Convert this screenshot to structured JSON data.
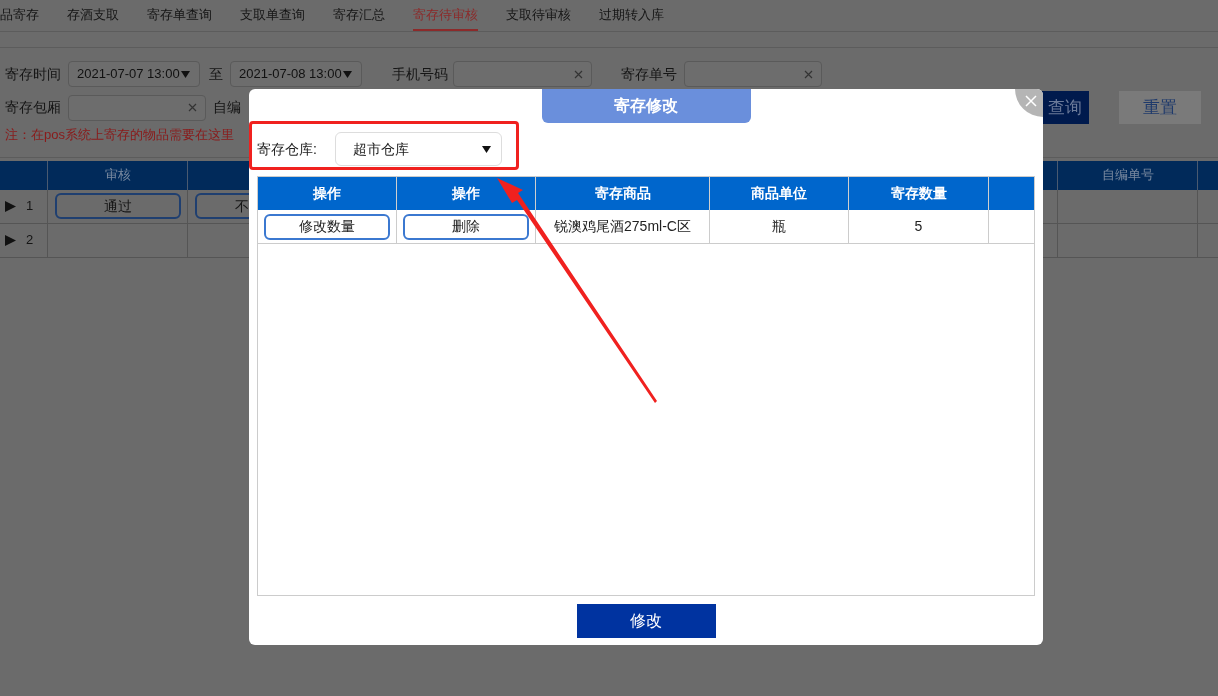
{
  "tabs": [
    {
      "label": "品寄存",
      "selected": false
    },
    {
      "label": "存酒支取",
      "selected": false
    },
    {
      "label": "寄存单查询",
      "selected": false
    },
    {
      "label": "支取单查询",
      "selected": false
    },
    {
      "label": "寄存汇总",
      "selected": false
    },
    {
      "label": "寄存待审核",
      "selected": true
    },
    {
      "label": "支取待审核",
      "selected": false
    },
    {
      "label": "过期转入库",
      "selected": false
    }
  ],
  "filters": {
    "time_label": "寄存时间",
    "time_from": "2021-07-07 13:00",
    "to_label": "至",
    "time_to": "2021-07-08 13:00",
    "phone_label": "手机号码",
    "order_label": "寄存单号",
    "room_label": "寄存包厢",
    "self_no_label": "自编"
  },
  "buttons": {
    "query": "查询",
    "reset": "重置"
  },
  "note": "注：在pos系统上寄存的物品需要在这里",
  "table": {
    "columns": [
      "审核",
      "自编单号"
    ],
    "rows": [
      {
        "index": "1",
        "approve": "通过",
        "reject": "不"
      },
      {
        "index": "2"
      }
    ]
  },
  "dialog": {
    "title": "寄存修改",
    "warehouse_label": "寄存仓库:",
    "warehouse": "超市仓库",
    "columns": [
      "操作",
      "操作",
      "寄存商品",
      "商品单位",
      "寄存数量"
    ],
    "rows": [
      {
        "edit": "修改数量",
        "delete": "删除",
        "product": "锐澳鸡尾酒275ml-C区",
        "unit": "瓶",
        "quantity": "5"
      }
    ],
    "submit": "修改"
  }
}
